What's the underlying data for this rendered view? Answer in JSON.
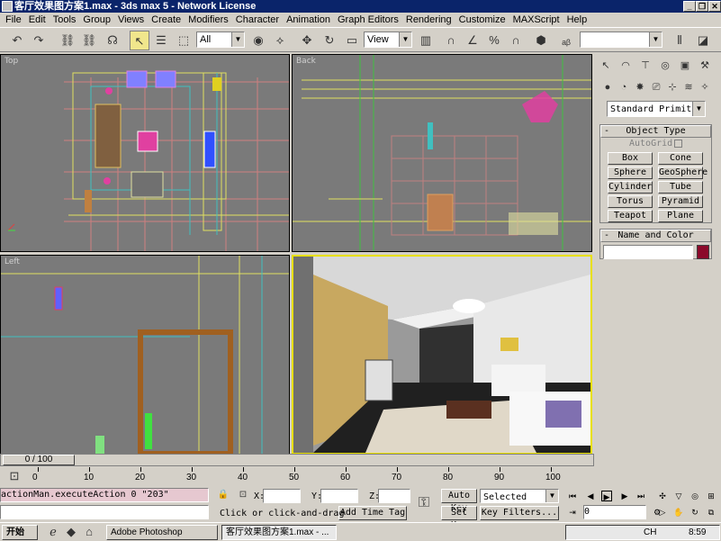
{
  "window": {
    "title": "客厅效果图方案1.max - 3ds max 5 - Network License"
  },
  "menu": [
    "File",
    "Edit",
    "Tools",
    "Group",
    "Views",
    "Create",
    "Modifiers",
    "Character",
    "Animation",
    "Graph Editors",
    "Rendering",
    "Customize",
    "MAXScript",
    "Help"
  ],
  "toolbar": {
    "selection_filter": "All",
    "ref_coord": "View",
    "named_sel": ""
  },
  "viewports": {
    "top": "Top",
    "back": "Back",
    "left": "Left",
    "persp": ""
  },
  "panel": {
    "category": "Standard Primitiv",
    "object_type_title": "Object Type",
    "autogrid": "AutoGrid",
    "buttons": [
      "Box",
      "Cone",
      "Sphere",
      "GeoSphere",
      "Cylinder",
      "Tube",
      "Torus",
      "Pyramid",
      "Teapot",
      "Plane"
    ],
    "name_color_title": "Name and Color",
    "object_color": "#8b0a2a"
  },
  "timeline": {
    "frame": "0 / 100",
    "ticks": [
      "0",
      "10",
      "20",
      "30",
      "40",
      "50",
      "60",
      "70",
      "80",
      "90",
      "100"
    ]
  },
  "status": {
    "script_line": "actionMan.executeAction 0 \"203\"",
    "prompt": "Click or click-and-drag",
    "add_time_tag": "Add Time Tag",
    "x_label": "X:",
    "y_label": "Y:",
    "z_label": "Z:",
    "auto_key": "Auto Key",
    "set_key": "Set Key",
    "key_mode": "Selected",
    "key_filters": "Key Filters...",
    "current_frame": "0"
  },
  "taskbar": {
    "start": "开始",
    "tasks": [
      "Adobe Photoshop",
      "客厅效果图方案1.max - ..."
    ],
    "clock": "8:59",
    "lang": "CH"
  },
  "colors": {
    "title_bg": "#0a246a",
    "active_border": "#e8e000",
    "viewport_bg": "#7a7a7a"
  }
}
